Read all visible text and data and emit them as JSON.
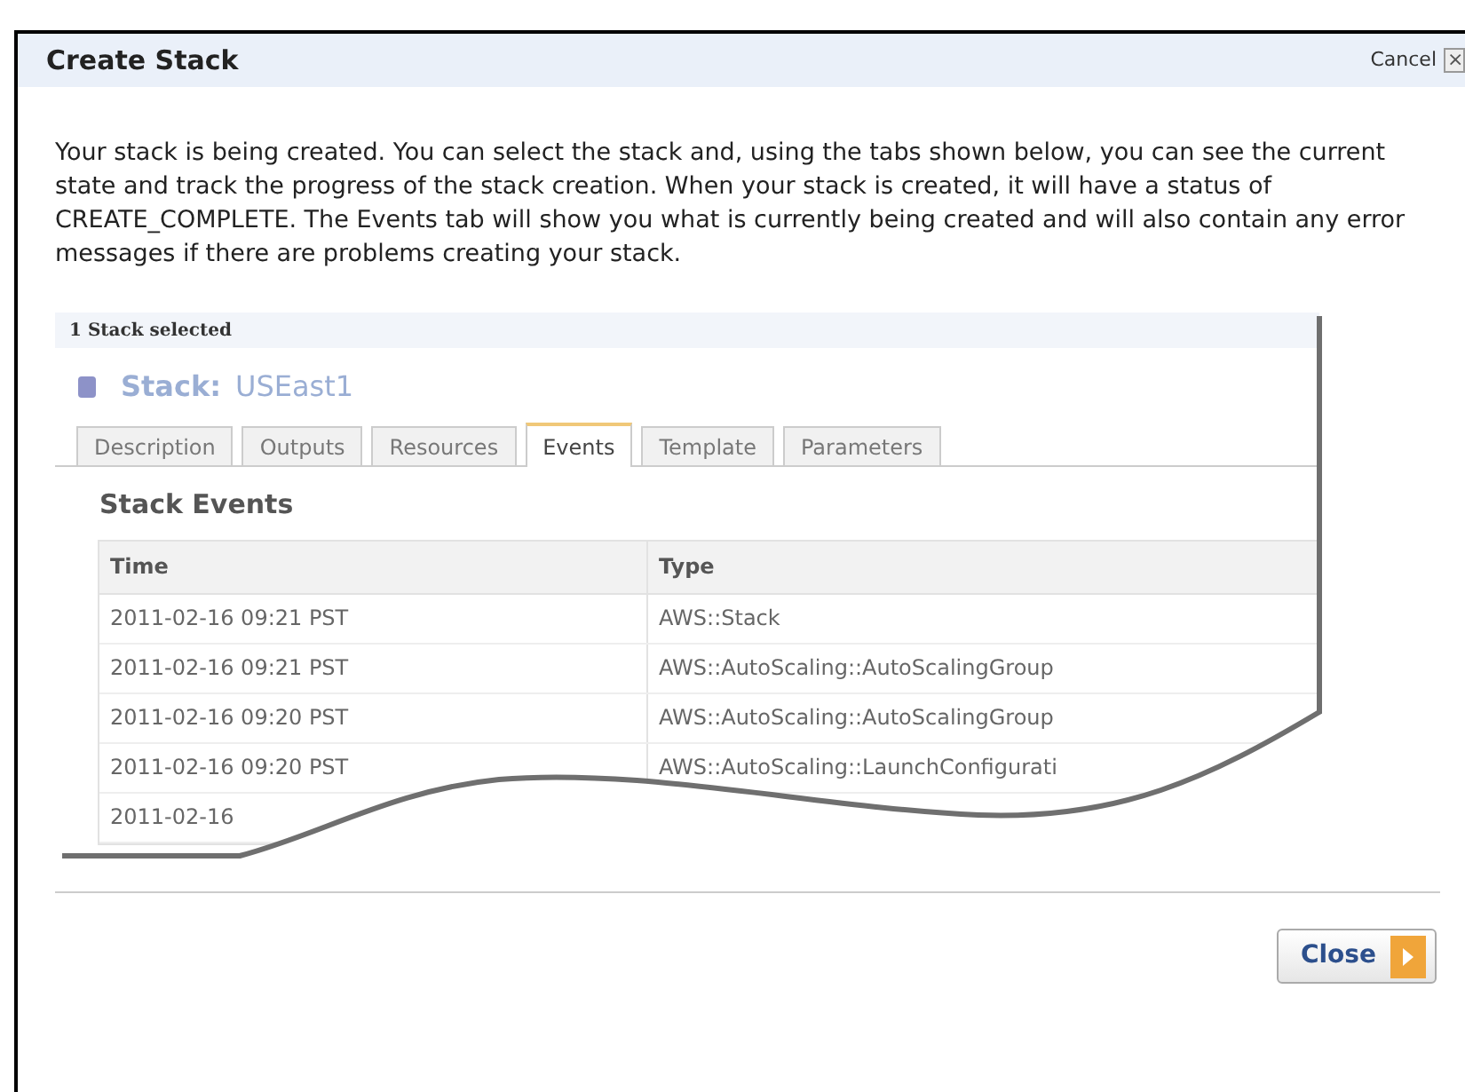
{
  "dialog": {
    "title": "Create Stack",
    "cancel": "Cancel",
    "close_glyph": "×"
  },
  "message": "Your stack is being created. You can select the stack and, using the tabs shown below, you can see the current state and track the progress of the stack creation. When your stack is created, it will have a status of CREATE_COMPLETE. The Events tab will show you what is currently being created and will also contain any error messages if there are problems creating your stack.",
  "panel": {
    "selection": "1 Stack selected",
    "stack_label": "Stack:",
    "stack_name": "USEast1",
    "tabs": [
      {
        "label": "Description",
        "selected": false
      },
      {
        "label": "Outputs",
        "selected": false
      },
      {
        "label": "Resources",
        "selected": false
      },
      {
        "label": "Events",
        "selected": true
      },
      {
        "label": "Template",
        "selected": false
      },
      {
        "label": "Parameters",
        "selected": false
      }
    ],
    "section_title": "Stack Events",
    "table": {
      "columns": [
        "Time",
        "Type"
      ],
      "rows": [
        [
          "2011-02-16 09:21 PST",
          "AWS::Stack"
        ],
        [
          "2011-02-16 09:21 PST",
          "AWS::AutoScaling::AutoScalingGroup"
        ],
        [
          "2011-02-16 09:20 PST",
          "AWS::AutoScaling::AutoScalingGroup"
        ],
        [
          "2011-02-16 09:20 PST",
          "AWS::AutoScaling::LaunchConfigurati"
        ],
        [
          "2011-02-16",
          ""
        ]
      ]
    }
  },
  "buttons": [
    {
      "label": "Close"
    }
  ]
}
